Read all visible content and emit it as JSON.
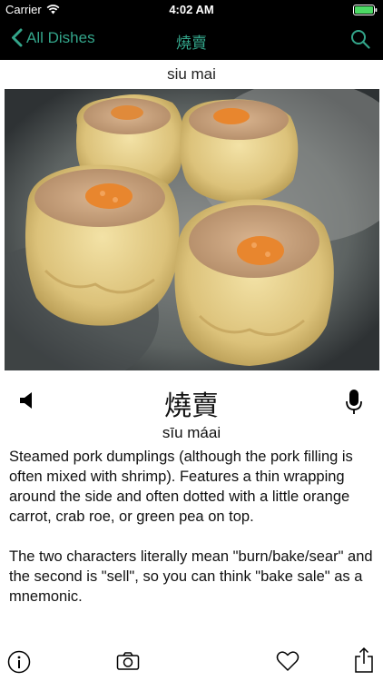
{
  "status": {
    "carrier": "Carrier",
    "time": "4:02 AM"
  },
  "nav": {
    "back_label": "All Dishes",
    "title": "燒賣"
  },
  "dish": {
    "romanized": "siu mai",
    "hanzi": "燒賣",
    "jyutping": "sīu máai",
    "description": [
      "Steamed pork dumplings (although the pork filling is often mixed with shrimp). Features a thin wrapping around the side and often dotted with a little orange carrot, crab roe, or green pea on top.",
      "The two characters literally mean \"burn/bake/sear\" and the second is \"sell\", so you can think \"bake sale\" as a mnemonic."
    ]
  },
  "toolbar": {
    "icons": [
      "info-icon",
      "camera-icon",
      "heart-icon",
      "share-icon"
    ]
  },
  "colors": {
    "accent": "#33a58a",
    "bar": "#000000",
    "battery": "#4cd964"
  }
}
